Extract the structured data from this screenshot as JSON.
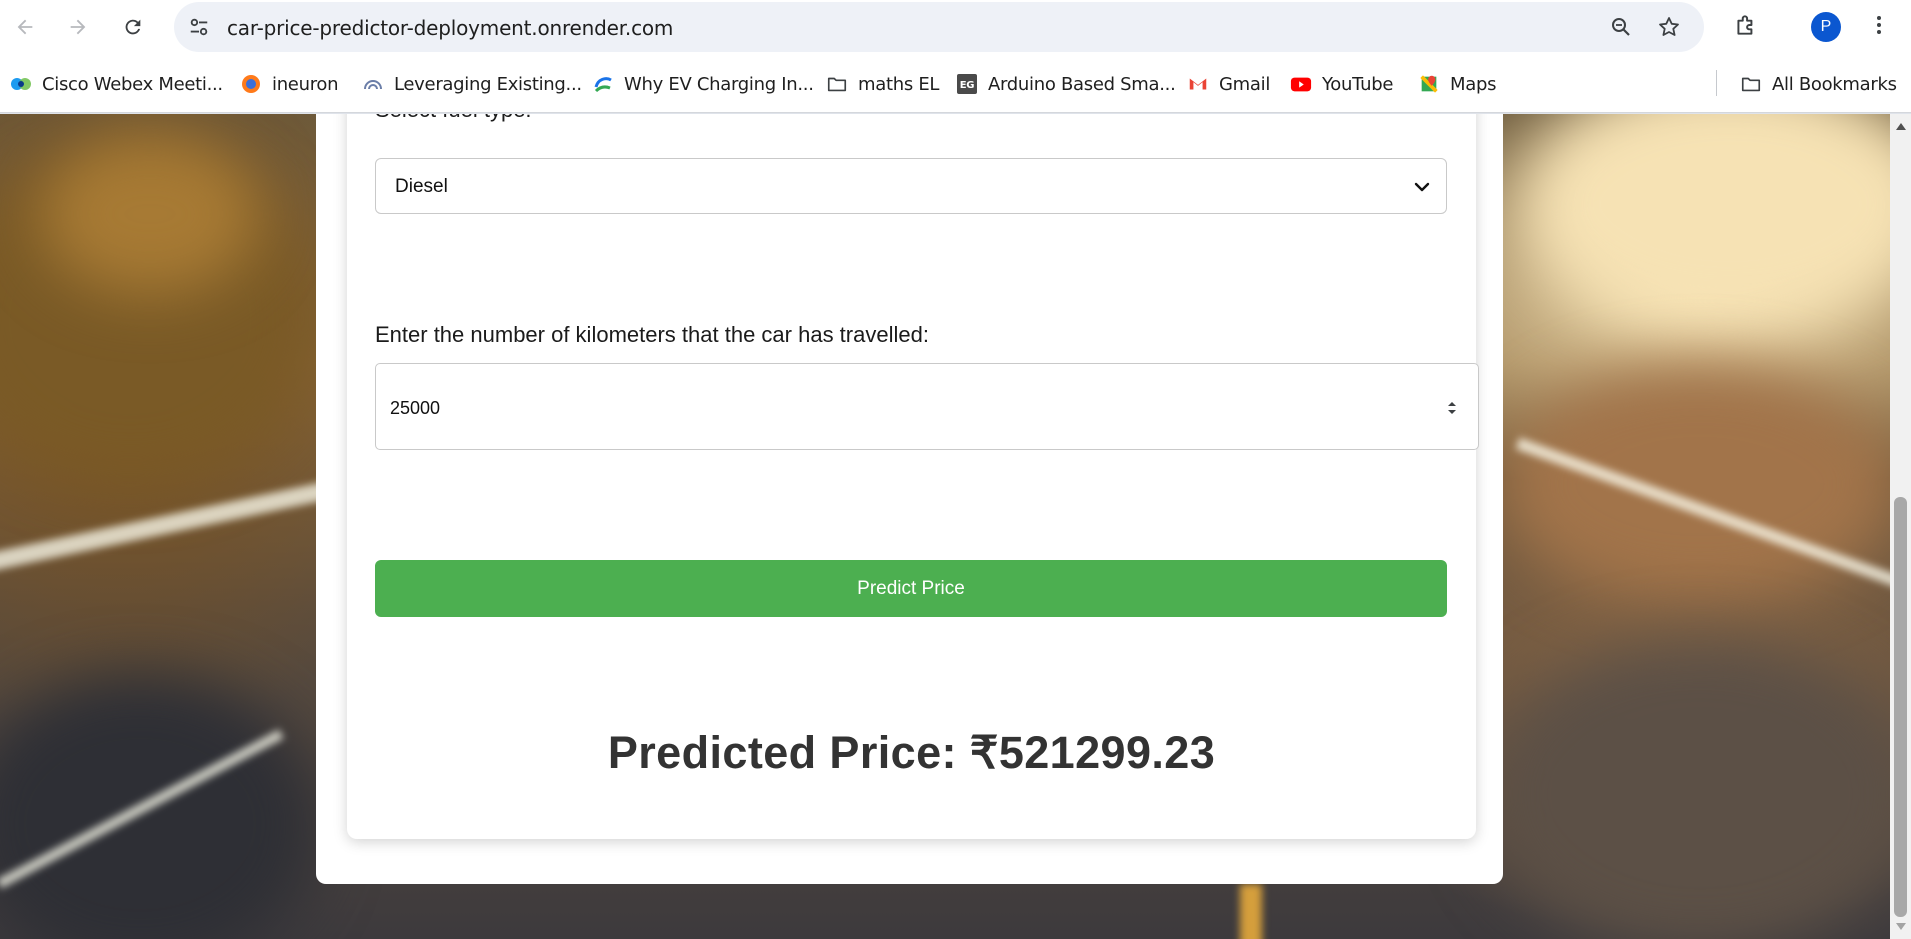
{
  "browser": {
    "url": "car-price-predictor-deployment.onrender.com",
    "avatar_letter": "P",
    "icons": [
      "back-arrow-icon",
      "forward-arrow-icon",
      "reload-icon",
      "site-settings-icon",
      "zoom-icon",
      "star-icon",
      "extensions-icon",
      "kebab-menu-icon"
    ]
  },
  "bookmarks": {
    "items": [
      {
        "label": "Cisco Webex Meeti...",
        "icon": "webex-icon"
      },
      {
        "label": "ineuron",
        "icon": "ineuron-icon"
      },
      {
        "label": "Leveraging Existing...",
        "icon": "leveraging-icon"
      },
      {
        "label": "Why EV Charging In...",
        "icon": "ev-charging-icon"
      },
      {
        "label": "maths EL",
        "icon": "folder-icon"
      },
      {
        "label": "Arduino Based Sma...",
        "icon": "eg-icon"
      },
      {
        "label": "Gmail",
        "icon": "gmail-icon"
      },
      {
        "label": "YouTube",
        "icon": "youtube-icon"
      },
      {
        "label": "Maps",
        "icon": "maps-icon"
      }
    ],
    "all_bookmarks": "All Bookmarks"
  },
  "form": {
    "fuel_label": "Select fuel type:",
    "fuel_value": "Diesel",
    "km_label": "Enter the number of kilometers that the car has travelled:",
    "km_value": "25000",
    "predict_button": "Predict Price",
    "result": "Predicted Price: ₹521299.23"
  },
  "colors": {
    "predict_button": "#4caf50",
    "avatar": "#0b57d0",
    "result_text": "#333333"
  }
}
